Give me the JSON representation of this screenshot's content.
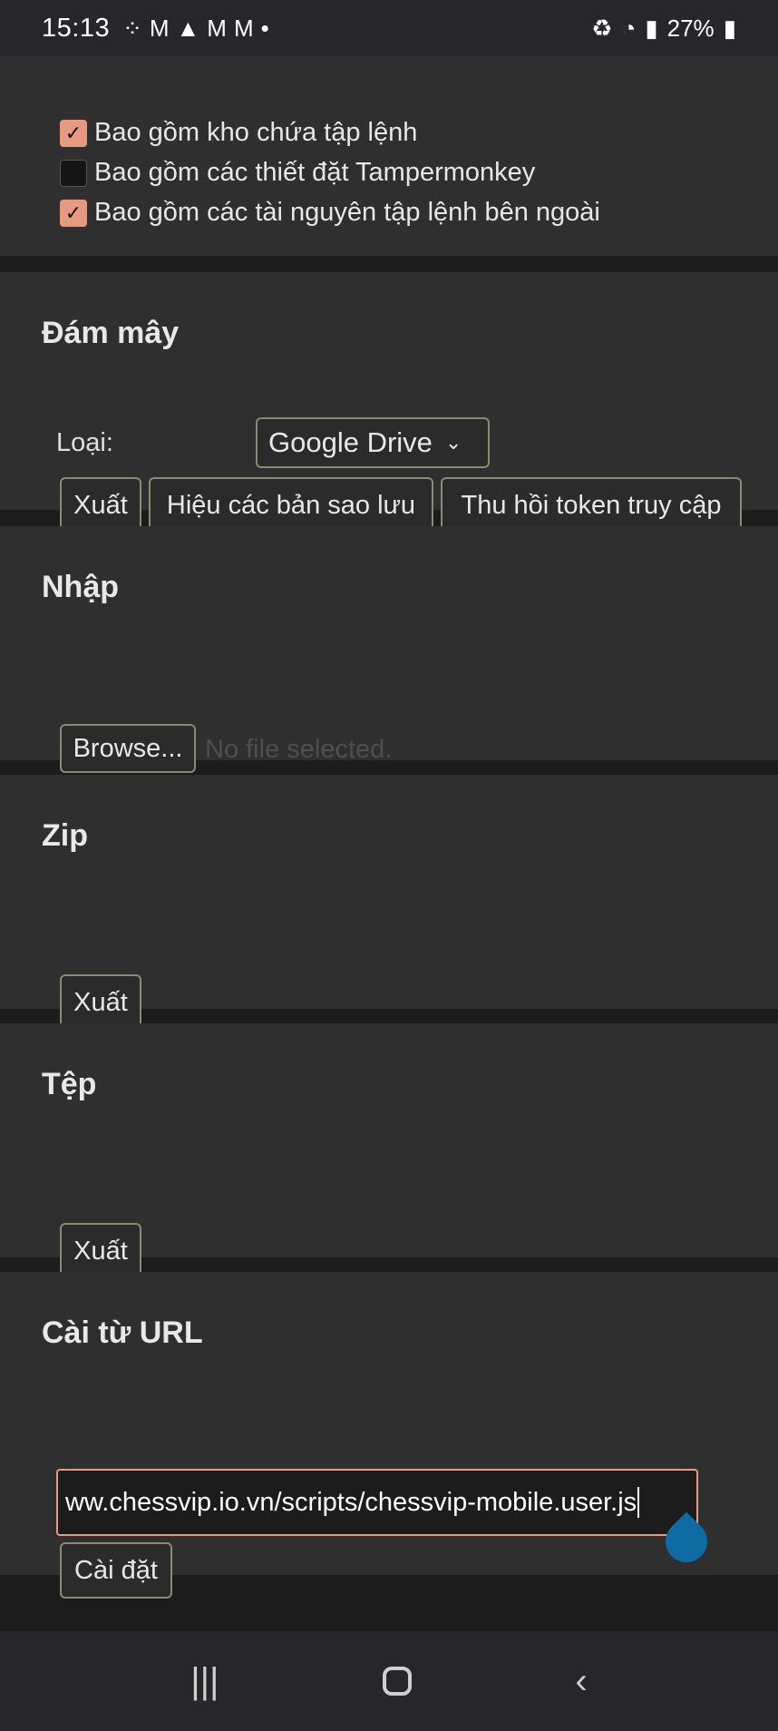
{
  "status_bar": {
    "time": "15:13",
    "notif_icons": [
      "app-icon",
      "gmail-icon",
      "warning-icon",
      "gmail-icon",
      "gmail-icon",
      "dot-icon"
    ],
    "right": {
      "battery_text": "27%",
      "icons": [
        "battery-saver-icon",
        "wifi-icon",
        "signal-icon",
        "battery-icon"
      ]
    }
  },
  "options": {
    "items": [
      {
        "label": "Bao gồm kho chứa tập lệnh",
        "checked": true
      },
      {
        "label": "Bao gồm các thiết đặt Tampermonkey",
        "checked": false
      },
      {
        "label": "Bao gồm các tài nguyên tập lệnh bên ngoài",
        "checked": true
      }
    ]
  },
  "cloud": {
    "title": "Đám mây",
    "type_label": "Loại:",
    "type_value": "Google Drive",
    "buttons": {
      "export": "Xuất",
      "show_backups": "Hiệu các bản sao lưu",
      "revoke": "Thu hồi token truy cập"
    }
  },
  "import": {
    "title": "Nhập",
    "browse": "Browse...",
    "no_file": "No file selected."
  },
  "zip": {
    "title": "Zip",
    "export": "Xuất"
  },
  "file": {
    "title": "Tệp",
    "export": "Xuất"
  },
  "install_url": {
    "title": "Cài từ URL",
    "value": "ww.chessvip.io.vn/scripts/chessvip-mobile.user.js",
    "install": "Cài đặt"
  },
  "colors": {
    "accent": "#e89a80",
    "panel": "#2f2f2f",
    "handle": "#0f6ca3"
  }
}
